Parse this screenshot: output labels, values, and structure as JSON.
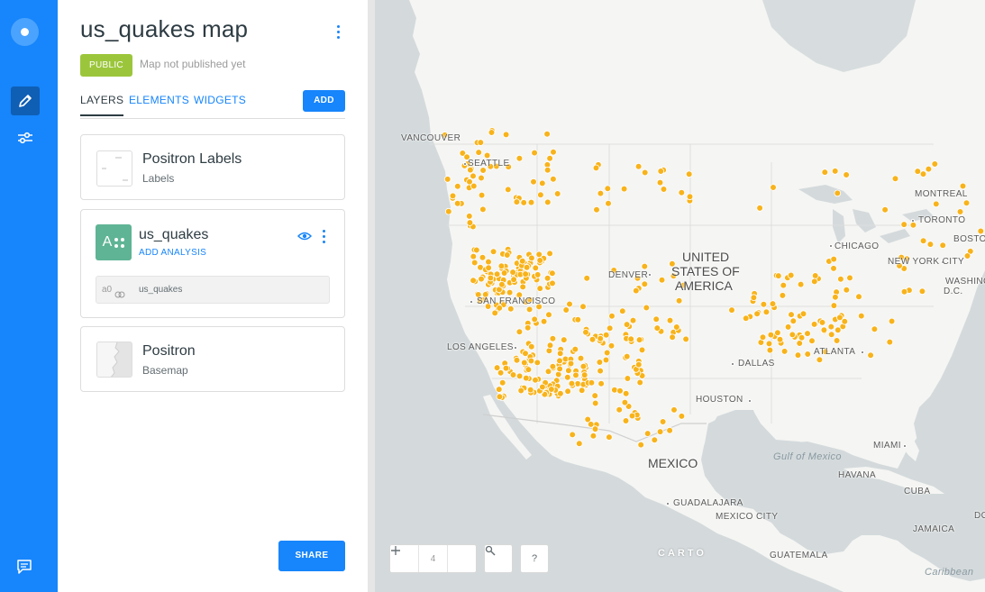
{
  "app": {
    "map_title": "us_quakes map",
    "privacy_badge": "PUBLIC",
    "publish_status": "Map not published yet"
  },
  "rail": {
    "icons": [
      "carto-logo-icon",
      "edit-pencil-icon",
      "settings-sliders-icon",
      "feedback-chat-icon"
    ]
  },
  "tabs": {
    "layers": "LAYERS",
    "elements": "ELEMENTS",
    "widgets": "WIDGETS",
    "add_label": "ADD"
  },
  "layers": [
    {
      "title": "Positron Labels",
      "subtitle": "Labels"
    },
    {
      "title": "us_quakes",
      "letter": "A",
      "link": "ADD ANALYSIS",
      "analysis_id": "a0",
      "analysis_source": "us_quakes"
    },
    {
      "title": "Positron",
      "subtitle": "Basemap"
    }
  ],
  "share_label": "SHARE",
  "map": {
    "zoom_level": "4",
    "help_label": "?",
    "attribution": "CARTO",
    "point_color": "#f8b31b",
    "labels": {
      "vancouver": "VANCOUVER",
      "seattle": "SEATTLE",
      "san_francisco": "SAN FRANCISCO",
      "los_angeles": "LOS ANGELES",
      "denver": "DENVER",
      "dallas": "DALLAS",
      "houston": "HOUSTON",
      "chicago": "CHICAGO",
      "atlanta": "ATLANTA",
      "new_york": "NEW YORK CITY",
      "washington_1": "WASHING",
      "washington_2": "D.C.",
      "montreal": "MONTREAL",
      "toronto": "TORONTO",
      "boston": "BOSTO",
      "miami": "MIAMI",
      "havana": "HAVANA",
      "cuba": "CUBA",
      "jamaica": "JAMAICA",
      "mexico": "MEXICO",
      "guadalajara": "GUADALAJARA",
      "mexico_city": "MEXICO CITY",
      "guatemala": "GUATEMALA",
      "usa_1": "UNITED",
      "usa_2": "STATES OF",
      "usa_3": "AMERICA",
      "gulf": "Gulf of Mexico",
      "caribbean": "Caribbean",
      "do": "DO"
    }
  }
}
